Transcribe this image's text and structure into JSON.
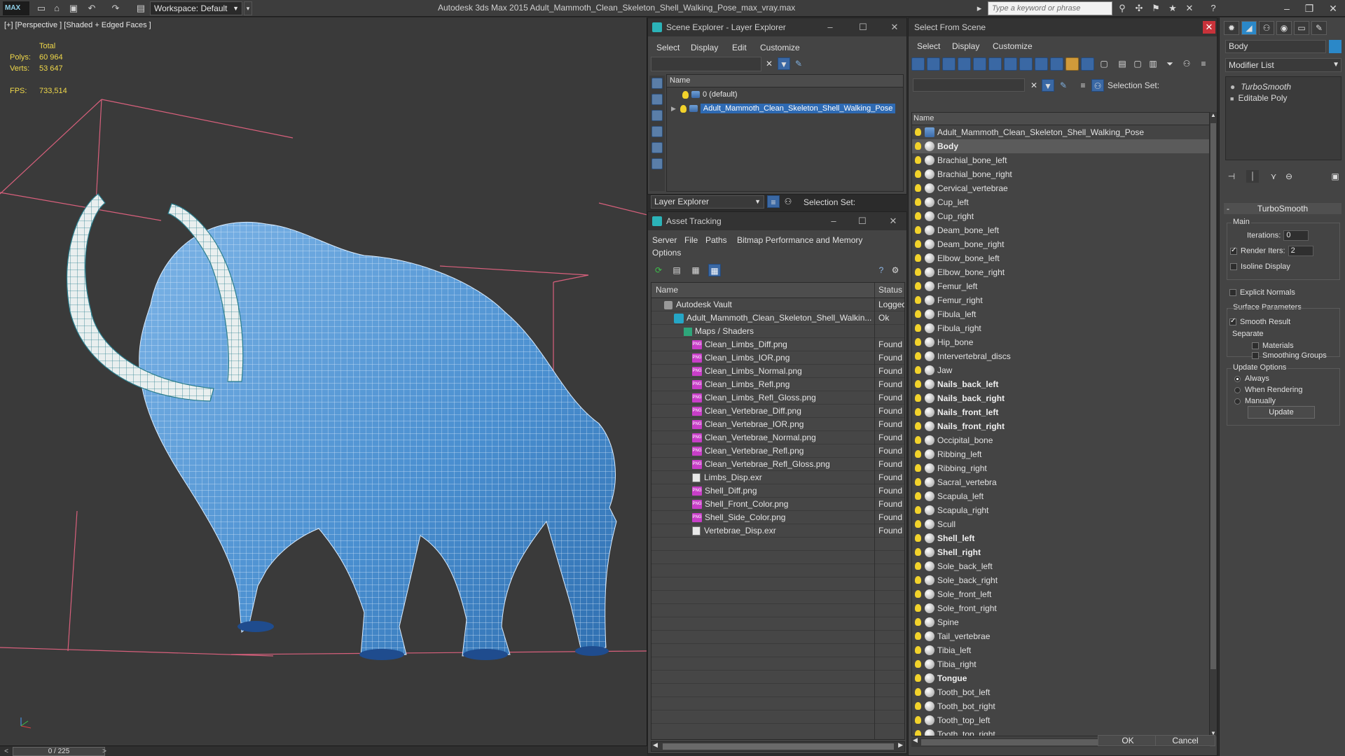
{
  "titlebar": {
    "app_icon": "MAX",
    "workspace": "Workspace: Default",
    "window_title": "Autodesk 3ds Max  2015     Adult_Mammoth_Clean_Skeleton_Shell_Walking_Pose_max_vray.max",
    "search_placeholder": "Type a keyword or phrase"
  },
  "viewport": {
    "label": "[+] [Perspective ] [Shaded + Edged Faces ]",
    "stats": {
      "total_label": "Total",
      "polys_label": "Polys:",
      "polys_value": "60 964",
      "verts_label": "Verts:",
      "verts_value": "53 647",
      "fps_label": "FPS:",
      "fps_value": "733,514"
    },
    "mesh_color": "#4a8fd0",
    "wire_color": "#e8f2ff",
    "grid_color": "#d8607c"
  },
  "timeline": {
    "frame": "0 / 225",
    "prev": "<",
    "next": ">"
  },
  "scene_explorer": {
    "title": "Scene Explorer - Layer Explorer",
    "menu": [
      "Select",
      "Display",
      "Edit",
      "Customize"
    ],
    "column_name": "Name",
    "layers": [
      {
        "label": "0 (default)",
        "selected": false
      },
      {
        "label": "Adult_Mammoth_Clean_Skeleton_Shell_Walking_Pose",
        "selected": true
      }
    ],
    "footer_label": "Layer Explorer",
    "selection_set_label": "Selection Set:"
  },
  "asset_tracking": {
    "title": "Asset Tracking",
    "menu": [
      "Server",
      "File",
      "Paths",
      "Bitmap Performance and Memory"
    ],
    "menu2": [
      "Options"
    ],
    "col_name": "Name",
    "col_status": "Status",
    "rows": [
      {
        "name": "Autodesk Vault",
        "status": "Logged",
        "indent": 18,
        "icon": "vault"
      },
      {
        "name": "Adult_Mammoth_Clean_Skeleton_Shell_Walkin...",
        "status": "Ok",
        "indent": 32,
        "icon": "file"
      },
      {
        "name": "Maps / Shaders",
        "status": "",
        "indent": 46,
        "icon": "folder"
      },
      {
        "name": "Clean_Limbs_Diff.png",
        "status": "Found",
        "indent": 58,
        "icon": "png"
      },
      {
        "name": "Clean_Limbs_IOR.png",
        "status": "Found",
        "indent": 58,
        "icon": "png"
      },
      {
        "name": "Clean_Limbs_Normal.png",
        "status": "Found",
        "indent": 58,
        "icon": "png"
      },
      {
        "name": "Clean_Limbs_Refl.png",
        "status": "Found",
        "indent": 58,
        "icon": "png"
      },
      {
        "name": "Clean_Limbs_Refl_Gloss.png",
        "status": "Found",
        "indent": 58,
        "icon": "png"
      },
      {
        "name": "Clean_Vertebrae_Diff.png",
        "status": "Found",
        "indent": 58,
        "icon": "png"
      },
      {
        "name": "Clean_Vertebrae_IOR.png",
        "status": "Found",
        "indent": 58,
        "icon": "png"
      },
      {
        "name": "Clean_Vertebrae_Normal.png",
        "status": "Found",
        "indent": 58,
        "icon": "png"
      },
      {
        "name": "Clean_Vertebrae_Refl.png",
        "status": "Found",
        "indent": 58,
        "icon": "png"
      },
      {
        "name": "Clean_Vertebrae_Refl_Gloss.png",
        "status": "Found",
        "indent": 58,
        "icon": "png"
      },
      {
        "name": "Limbs_Disp.exr",
        "status": "Found",
        "indent": 58,
        "icon": "exr"
      },
      {
        "name": "Shell_Diff.png",
        "status": "Found",
        "indent": 58,
        "icon": "png"
      },
      {
        "name": "Shell_Front_Color.png",
        "status": "Found",
        "indent": 58,
        "icon": "png"
      },
      {
        "name": "Shell_Side_Color.png",
        "status": "Found",
        "indent": 58,
        "icon": "png"
      },
      {
        "name": "Vertebrae_Disp.exr",
        "status": "Found",
        "indent": 58,
        "icon": "exr"
      }
    ]
  },
  "select_from_scene": {
    "title": "Select From Scene",
    "menu": [
      "Select",
      "Display",
      "Customize"
    ],
    "selection_set_label": "Selection Set:",
    "column_name": "Name",
    "items": [
      {
        "label": "Adult_Mammoth_Clean_Skeleton_Shell_Walking_Pose",
        "bold": false,
        "hl": false,
        "icon": "layer"
      },
      {
        "label": "Body",
        "bold": true,
        "hl": true,
        "icon": "sphere"
      },
      {
        "label": "Brachial_bone_left",
        "bold": false,
        "hl": false,
        "icon": "sphere"
      },
      {
        "label": "Brachial_bone_right",
        "bold": false,
        "hl": false,
        "icon": "sphere"
      },
      {
        "label": "Cervical_vertebrae",
        "bold": false,
        "hl": false,
        "icon": "sphere"
      },
      {
        "label": "Cup_left",
        "bold": false,
        "hl": false,
        "icon": "sphere"
      },
      {
        "label": "Cup_right",
        "bold": false,
        "hl": false,
        "icon": "sphere"
      },
      {
        "label": "Deam_bone_left",
        "bold": false,
        "hl": false,
        "icon": "sphere"
      },
      {
        "label": "Deam_bone_right",
        "bold": false,
        "hl": false,
        "icon": "sphere"
      },
      {
        "label": "Elbow_bone_left",
        "bold": false,
        "hl": false,
        "icon": "sphere"
      },
      {
        "label": "Elbow_bone_right",
        "bold": false,
        "hl": false,
        "icon": "sphere"
      },
      {
        "label": "Femur_left",
        "bold": false,
        "hl": false,
        "icon": "sphere"
      },
      {
        "label": "Femur_right",
        "bold": false,
        "hl": false,
        "icon": "sphere"
      },
      {
        "label": "Fibula_left",
        "bold": false,
        "hl": false,
        "icon": "sphere"
      },
      {
        "label": "Fibula_right",
        "bold": false,
        "hl": false,
        "icon": "sphere"
      },
      {
        "label": "Hip_bone",
        "bold": false,
        "hl": false,
        "icon": "sphere"
      },
      {
        "label": "Intervertebral_discs",
        "bold": false,
        "hl": false,
        "icon": "sphere"
      },
      {
        "label": "Jaw",
        "bold": false,
        "hl": false,
        "icon": "sphere"
      },
      {
        "label": "Nails_back_left",
        "bold": true,
        "hl": false,
        "icon": "sphere"
      },
      {
        "label": "Nails_back_right",
        "bold": true,
        "hl": false,
        "icon": "sphere"
      },
      {
        "label": "Nails_front_left",
        "bold": true,
        "hl": false,
        "icon": "sphere"
      },
      {
        "label": "Nails_front_right",
        "bold": true,
        "hl": false,
        "icon": "sphere"
      },
      {
        "label": "Occipital_bone",
        "bold": false,
        "hl": false,
        "icon": "sphere"
      },
      {
        "label": "Ribbing_left",
        "bold": false,
        "hl": false,
        "icon": "sphere"
      },
      {
        "label": "Ribbing_right",
        "bold": false,
        "hl": false,
        "icon": "sphere"
      },
      {
        "label": "Sacral_vertebra",
        "bold": false,
        "hl": false,
        "icon": "sphere"
      },
      {
        "label": "Scapula_left",
        "bold": false,
        "hl": false,
        "icon": "sphere"
      },
      {
        "label": "Scapula_right",
        "bold": false,
        "hl": false,
        "icon": "sphere"
      },
      {
        "label": "Scull",
        "bold": false,
        "hl": false,
        "icon": "sphere"
      },
      {
        "label": "Shell_left",
        "bold": true,
        "hl": false,
        "icon": "sphere"
      },
      {
        "label": "Shell_right",
        "bold": true,
        "hl": false,
        "icon": "sphere"
      },
      {
        "label": "Sole_back_left",
        "bold": false,
        "hl": false,
        "icon": "sphere"
      },
      {
        "label": "Sole_back_right",
        "bold": false,
        "hl": false,
        "icon": "sphere"
      },
      {
        "label": "Sole_front_left",
        "bold": false,
        "hl": false,
        "icon": "sphere"
      },
      {
        "label": "Sole_front_right",
        "bold": false,
        "hl": false,
        "icon": "sphere"
      },
      {
        "label": "Spine",
        "bold": false,
        "hl": false,
        "icon": "sphere"
      },
      {
        "label": "Tail_vertebrae",
        "bold": false,
        "hl": false,
        "icon": "sphere"
      },
      {
        "label": "Tibia_left",
        "bold": false,
        "hl": false,
        "icon": "sphere"
      },
      {
        "label": "Tibia_right",
        "bold": false,
        "hl": false,
        "icon": "sphere"
      },
      {
        "label": "Tongue",
        "bold": true,
        "hl": false,
        "icon": "sphere"
      },
      {
        "label": "Tooth_bot_left",
        "bold": false,
        "hl": false,
        "icon": "sphere"
      },
      {
        "label": "Tooth_bot_right",
        "bold": false,
        "hl": false,
        "icon": "sphere"
      },
      {
        "label": "Tooth_top_left",
        "bold": false,
        "hl": false,
        "icon": "sphere"
      },
      {
        "label": "Tooth_top_right",
        "bold": false,
        "hl": false,
        "icon": "sphere"
      }
    ],
    "ok_label": "OK",
    "cancel_label": "Cancel"
  },
  "command_panel": {
    "object_name": "Body",
    "modifier_list_label": "Modifier List",
    "stack": [
      "TurboSmooth",
      "Editable Poly"
    ],
    "rollout_title": "TurboSmooth",
    "main_group": "Main",
    "iterations_label": "Iterations:",
    "iterations_value": "0",
    "render_iters_label": "Render Iters:",
    "render_iters_value": "2",
    "isoline_label": "Isoline Display",
    "explicit_normals_label": "Explicit Normals",
    "surface_group": "Surface Parameters",
    "smooth_result_label": "Smooth Result",
    "separate_label": "Separate",
    "materials_label": "Materials",
    "smoothing_groups_label": "Smoothing Groups",
    "update_group": "Update Options",
    "always_label": "Always",
    "when_rendering_label": "When Rendering",
    "manually_label": "Manually",
    "update_button": "Update"
  }
}
